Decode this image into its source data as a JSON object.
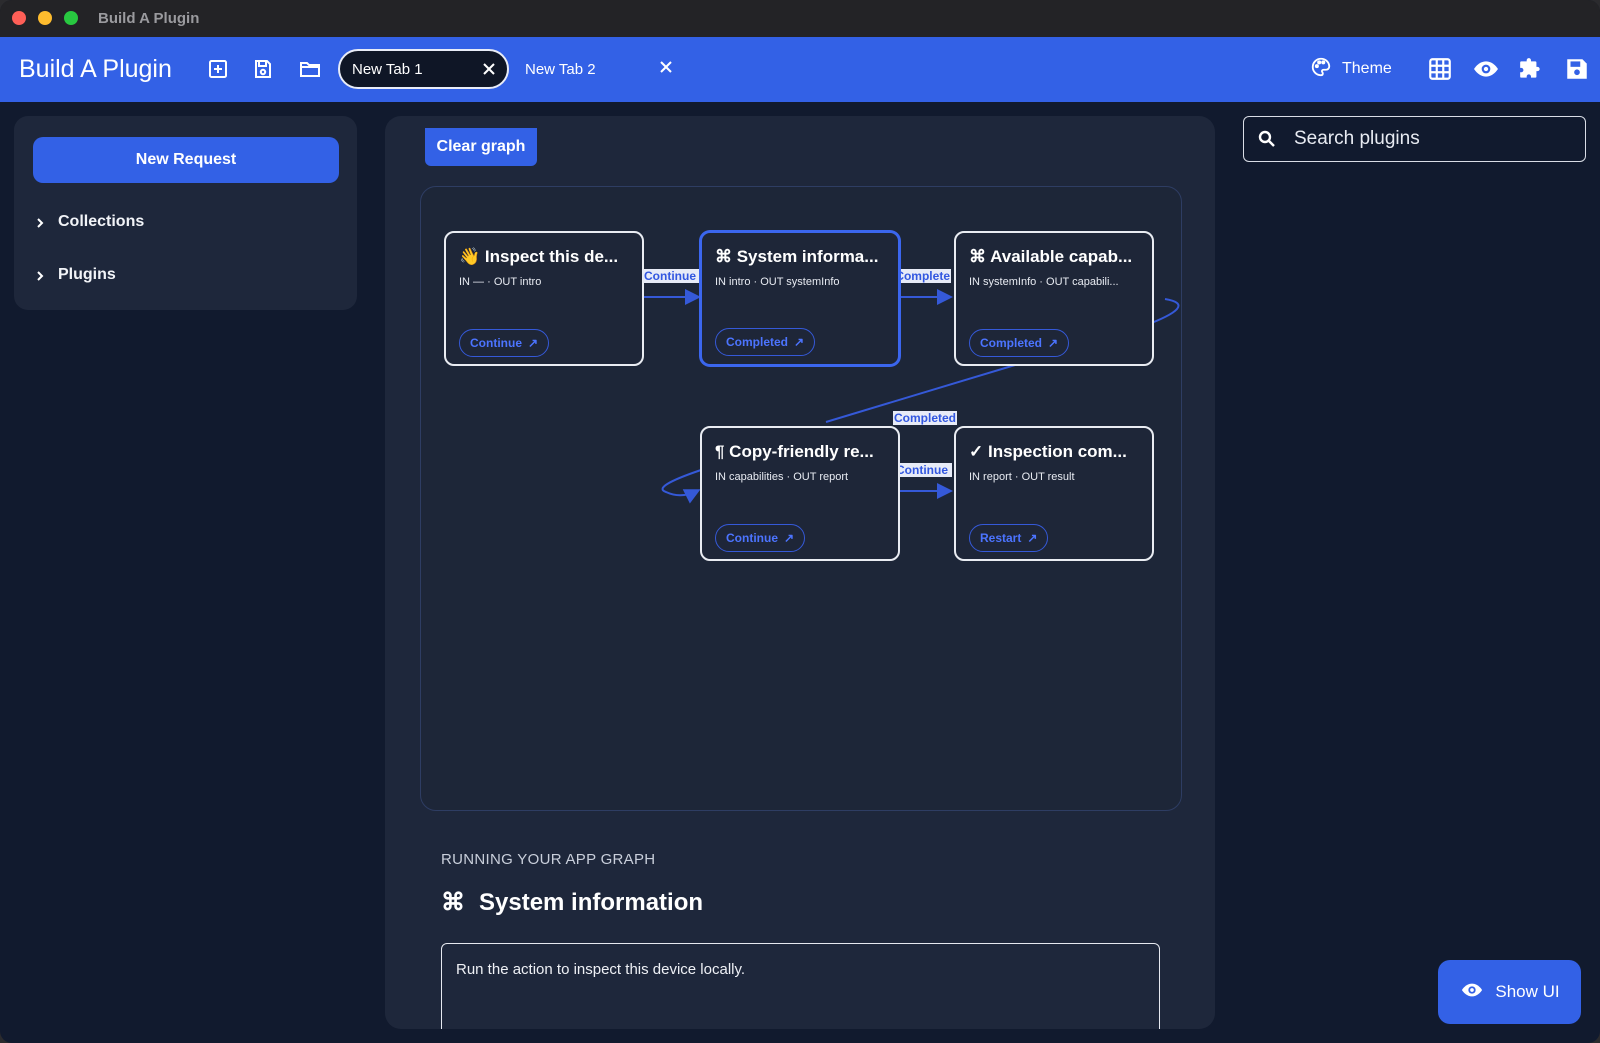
{
  "window": {
    "title": "Build A Plugin"
  },
  "header": {
    "app_title": "Build A Plugin",
    "tabs": [
      {
        "label": "New Tab 1",
        "active": true
      },
      {
        "label": "New Tab 2",
        "active": false
      }
    ],
    "theme_label": "Theme",
    "icons": [
      "add-tab-icon",
      "save-icon",
      "folder-icon",
      "palette-icon",
      "grid-icon",
      "eye-icon",
      "puzzle-icon",
      "save-icon"
    ]
  },
  "sidebar": {
    "new_request_label": "New Request",
    "items": [
      {
        "label": "Collections"
      },
      {
        "label": "Plugins"
      }
    ]
  },
  "graph": {
    "clear_label": "Clear graph",
    "nodes": [
      {
        "title": "👋 Inspect this de...",
        "io": "IN —   ·   OUT intro",
        "button": "Continue",
        "selected": false
      },
      {
        "title": "⌘ System informa...",
        "io": "IN intro   ·   OUT systemInfo",
        "button": "Completed",
        "selected": true
      },
      {
        "title": "⌘ Available capab...",
        "io": "IN systemInfo   ·   OUT capabili...",
        "button": "Completed",
        "selected": false
      },
      {
        "title": "¶ Copy-friendly re...",
        "io": "IN capabilities   ·   OUT report",
        "button": "Continue",
        "selected": false
      },
      {
        "title": "✓ Inspection com...",
        "io": "IN report   ·   OUT result",
        "button": "Restart",
        "selected": false
      }
    ],
    "edge_labels": [
      "Continue",
      "Complete",
      "Completed",
      "Continue"
    ]
  },
  "running": {
    "section_label": "RUNNING YOUR APP GRAPH",
    "title": "System information",
    "output_text": "Run the action to inspect this device locally."
  },
  "search": {
    "placeholder": "Search plugins"
  },
  "show_ui_label": "Show UI",
  "colors": {
    "accent": "#3361e6",
    "background": "#111a2e",
    "panel": "#1e273b",
    "edge": "#3559d8"
  }
}
